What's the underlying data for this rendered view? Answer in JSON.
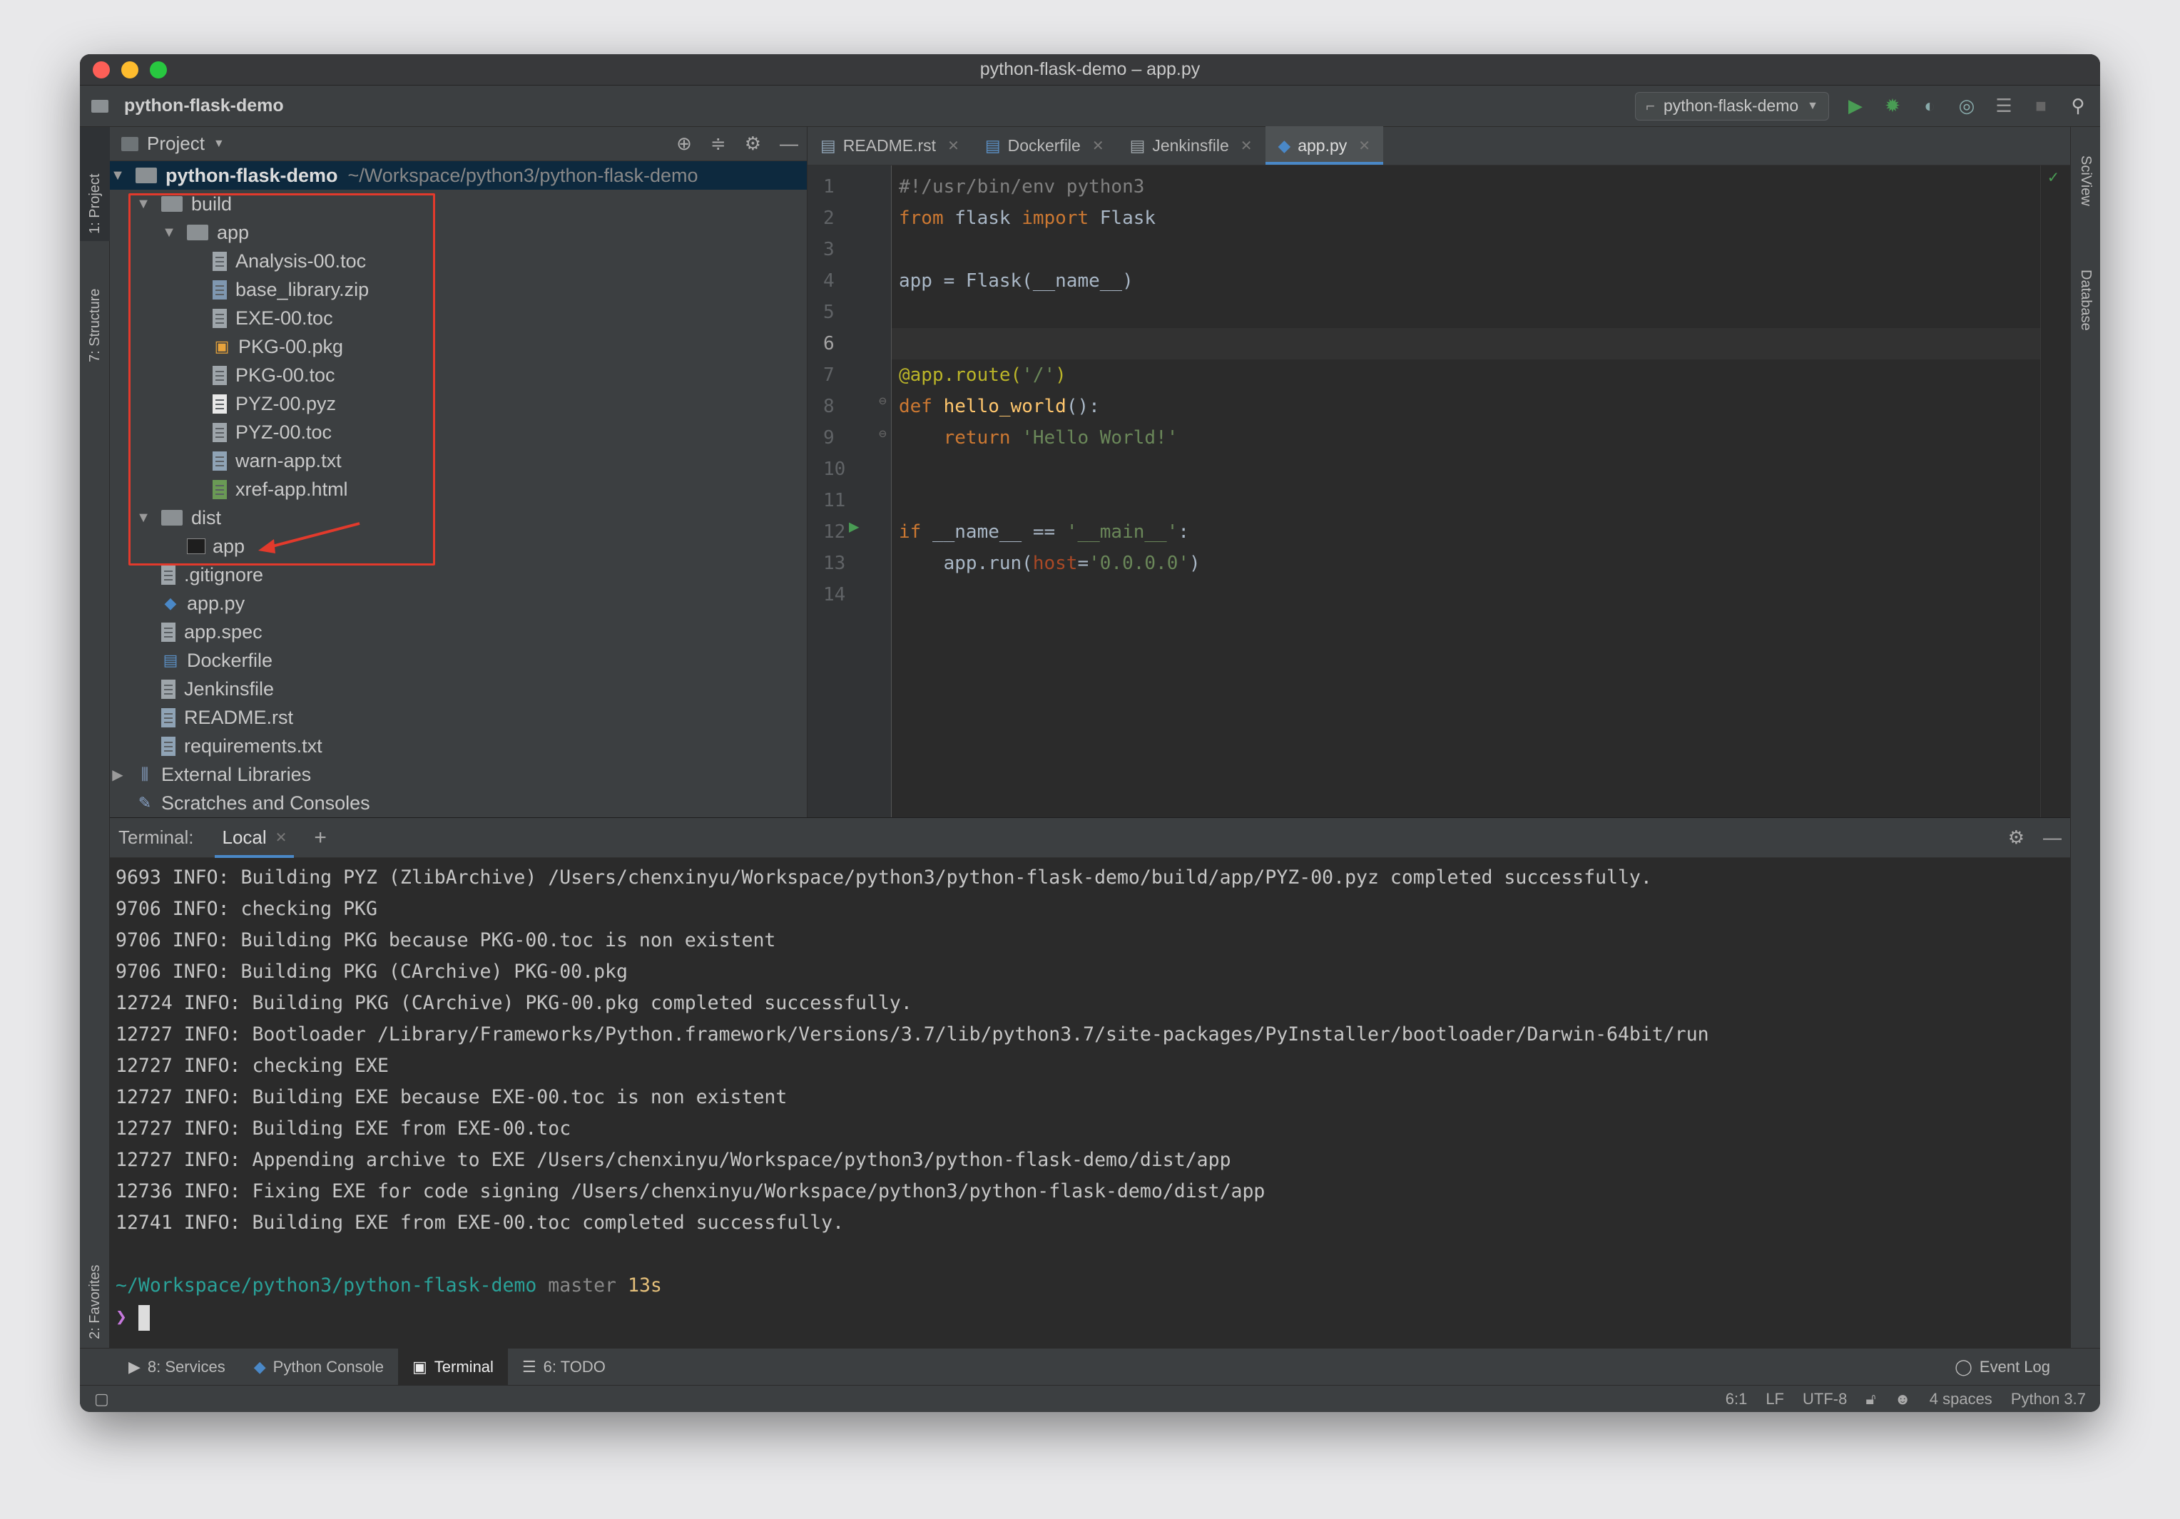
{
  "window": {
    "title": "python-flask-demo – app.py"
  },
  "navbar": {
    "project": "python-flask-demo",
    "run_config": "python-flask-demo"
  },
  "left_strip": {
    "project": "1: Project",
    "structure": "7: Structure",
    "favorites": "2: Favorites"
  },
  "right_strip": {
    "sciview": "SciView",
    "database": "Database"
  },
  "project_panel": {
    "header": "Project",
    "root": {
      "name": "python-flask-demo",
      "path": "~/Workspace/python3/python-flask-demo"
    },
    "build": "build",
    "build_app": "app",
    "build_files": [
      "Analysis-00.toc",
      "base_library.zip",
      "EXE-00.toc",
      "PKG-00.pkg",
      "PKG-00.toc",
      "PYZ-00.pyz",
      "PYZ-00.toc",
      "warn-app.txt",
      "xref-app.html"
    ],
    "dist": "dist",
    "dist_app": "app",
    "root_files": [
      ".gitignore",
      "app.py",
      "app.spec",
      "Dockerfile",
      "Jenkinsfile",
      "README.rst",
      "requirements.txt"
    ],
    "external_libraries": "External Libraries",
    "scratches": "Scratches and Consoles"
  },
  "editor": {
    "tabs": [
      "README.rst",
      "Dockerfile",
      "Jenkinsfile",
      "app.py"
    ],
    "line_numbers": [
      "1",
      "2",
      "3",
      "4",
      "5",
      "6",
      "7",
      "8",
      "9",
      "10",
      "11",
      "12",
      "13",
      "14"
    ]
  },
  "terminal": {
    "label": "Terminal:",
    "tab": "Local",
    "lines": [
      "9693 INFO: Building PYZ (ZlibArchive) /Users/chenxinyu/Workspace/python3/python-flask-demo/build/app/PYZ-00.pyz completed successfully.",
      "9706 INFO: checking PKG",
      "9706 INFO: Building PKG because PKG-00.toc is non existent",
      "9706 INFO: Building PKG (CArchive) PKG-00.pkg",
      "12724 INFO: Building PKG (CArchive) PKG-00.pkg completed successfully.",
      "12727 INFO: Bootloader /Library/Frameworks/Python.framework/Versions/3.7/lib/python3.7/site-packages/PyInstaller/bootloader/Darwin-64bit/run",
      "12727 INFO: checking EXE",
      "12727 INFO: Building EXE because EXE-00.toc is non existent",
      "12727 INFO: Building EXE from EXE-00.toc",
      "12727 INFO: Appending archive to EXE /Users/chenxinyu/Workspace/python3/python-flask-demo/dist/app",
      "12736 INFO: Fixing EXE for code signing /Users/chenxinyu/Workspace/python3/python-flask-demo/dist/app",
      "12741 INFO: Building EXE from EXE-00.toc completed successfully."
    ],
    "prompt_path": "~/Workspace/python3/python-flask-demo",
    "prompt_branch": "master",
    "prompt_time": "13s",
    "prompt_symbol": "❯"
  },
  "bottom_tools": {
    "services": "8: Services",
    "python_console": "Python Console",
    "terminal": "Terminal",
    "todo": "6: TODO",
    "event_log": "Event Log"
  },
  "status_bar": {
    "position": "6:1",
    "line_sep": "LF",
    "encoding": "UTF-8",
    "indent": "4 spaces",
    "interpreter": "Python 3.7"
  },
  "colors": {
    "accent": "#4a88c7",
    "highlight_box": "#e23a2c",
    "run_green": "#499c54"
  }
}
